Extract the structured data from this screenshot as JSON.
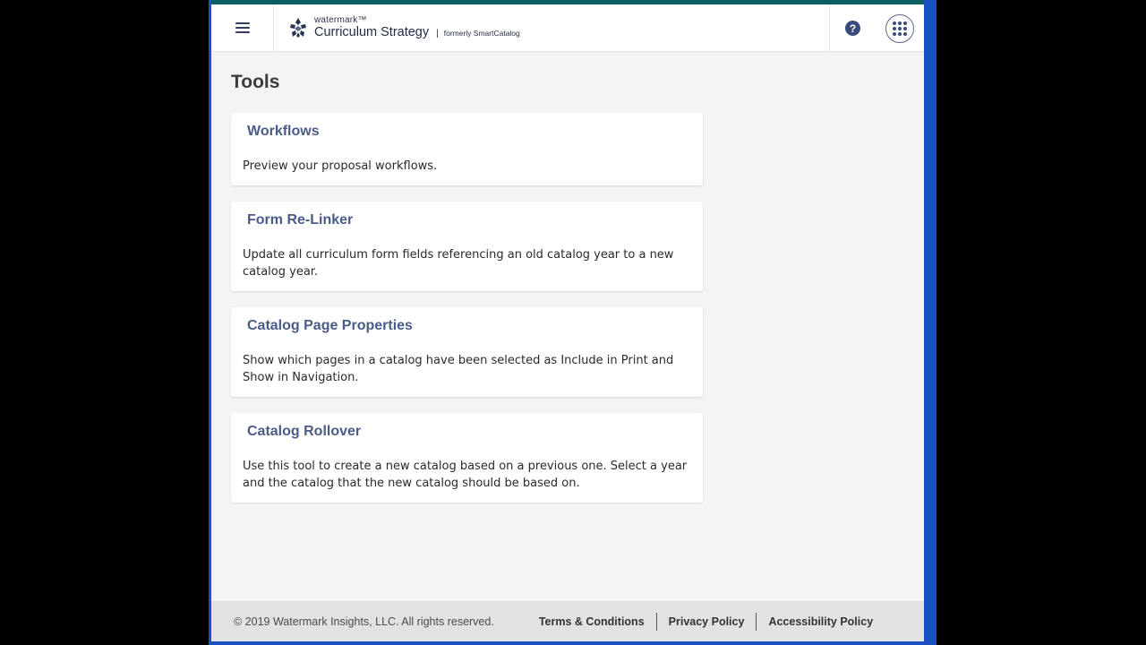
{
  "header": {
    "menu_icon": "hamburger-menu-icon",
    "brand_small": "watermark™",
    "brand_name": "Curriculum Strategy",
    "brand_separator": "|",
    "brand_formerly": "formerly SmartCatalog",
    "help_icon": "question-circle-icon",
    "help_glyph": "?",
    "apps_icon": "app-grid-icon"
  },
  "main": {
    "title": "Tools",
    "cards": [
      {
        "title": "Workflows",
        "description": "Preview your proposal workflows."
      },
      {
        "title": "Form Re-Linker",
        "description": "Update all curriculum form fields referencing an old catalog year to a new catalog year."
      },
      {
        "title": "Catalog Page Properties",
        "description": "Show which pages in a catalog have been selected as Include in Print and Show in Navigation."
      },
      {
        "title": "Catalog Rollover",
        "description": "Use this tool to create a new catalog based on a previous one. Select a year and the catalog that the new catalog should be based on."
      }
    ]
  },
  "footer": {
    "copyright": "© 2019 Watermark Insights, LLC. All rights reserved.",
    "links": [
      "Terms & Conditions",
      "Privacy Policy",
      "Accessibility Policy"
    ]
  },
  "colors": {
    "accent_bar": "#0d5e63",
    "card_title": "#4a5b86",
    "frame_border": "#1b4fc4",
    "background": "#f4f4f4"
  }
}
